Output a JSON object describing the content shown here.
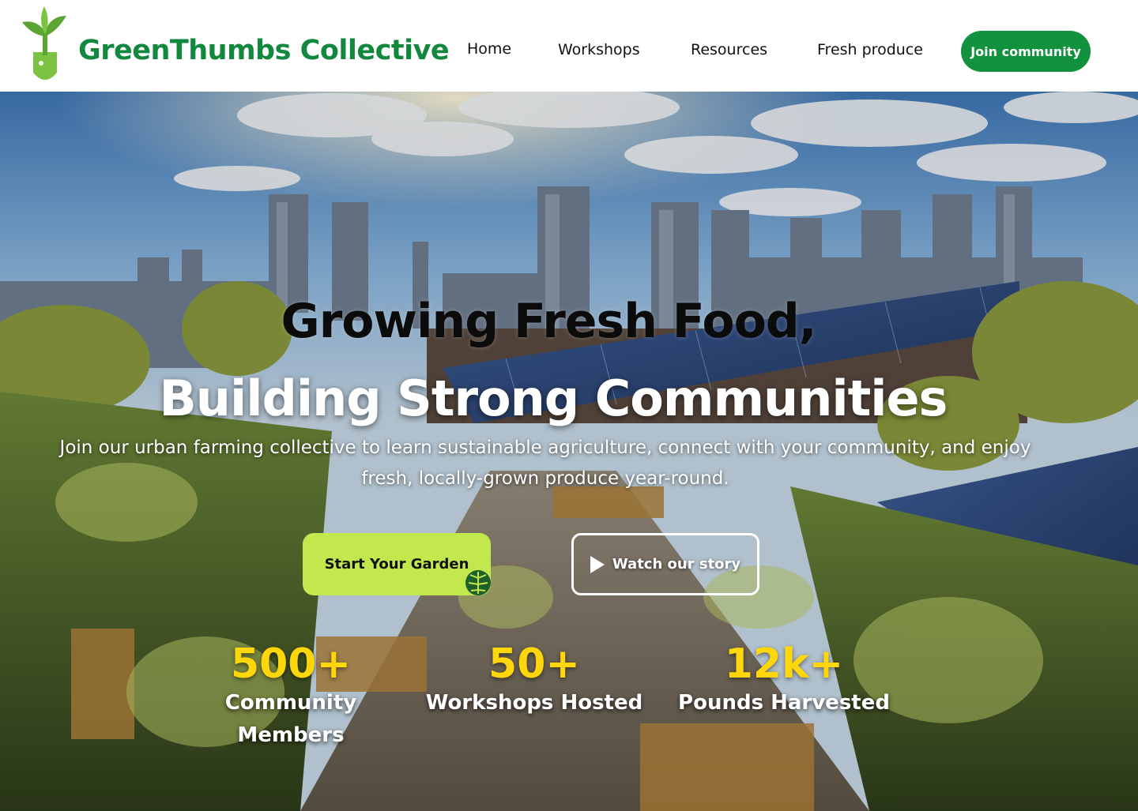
{
  "brand": {
    "name": "GreenThumbs Collective",
    "logo_icon": "sprout-shovel-icon",
    "color": "#12883f"
  },
  "nav": {
    "items": [
      {
        "label": "Home"
      },
      {
        "label": "Workshops"
      },
      {
        "label": "Resources"
      },
      {
        "label": "Fresh produce"
      }
    ],
    "cta_label": "Join community",
    "cta_color": "#12923f"
  },
  "hero": {
    "background": "rooftop-garden-city-skyline-solar-panels",
    "headline_line1": "Growing Fresh Food,",
    "headline_line2": "Building Strong Communities",
    "lead": "Join our urban farming collective to learn sustainable agriculture, connect with your community, and enjoy fresh, locally-grown produce year-round.",
    "primary_cta": "Start Your Garden",
    "primary_cta_icon": "monstera-leaf-icon",
    "primary_cta_color": "#c3e84d",
    "secondary_cta": "Watch our story",
    "secondary_cta_icon": "play-icon"
  },
  "stats": [
    {
      "value": "500+",
      "label": "Community Members"
    },
    {
      "value": "50+",
      "label": "Workshops Hosted"
    },
    {
      "value": "12k+",
      "label": "Pounds Harvested"
    }
  ],
  "stat_color": "#ffd60a"
}
